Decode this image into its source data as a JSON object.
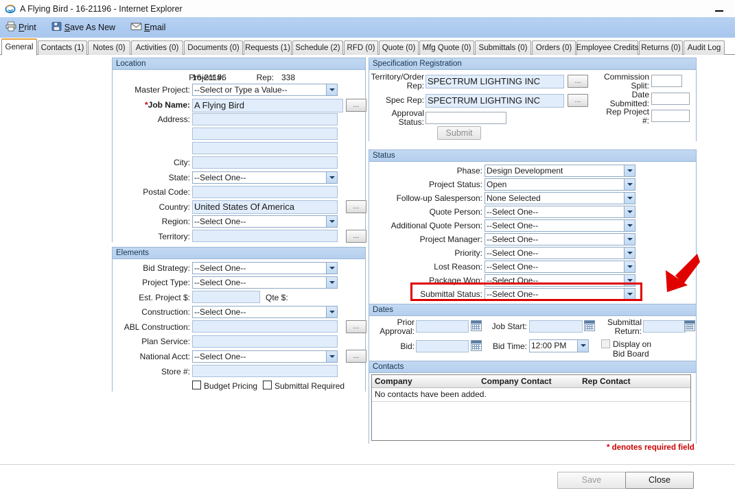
{
  "window": {
    "title": "A Flying Bird - 16-21196 - Internet Explorer",
    "app_icon": "internet-explorer-icon",
    "minimize_label": "—"
  },
  "toolbar": {
    "items": [
      {
        "label": "Print",
        "accel": "P",
        "icon": "printer-icon"
      },
      {
        "label": "Save As New",
        "accel": "S",
        "icon": "save-disk-icon"
      },
      {
        "label": "Email",
        "accel": "E",
        "icon": "envelope-icon"
      }
    ]
  },
  "tabs": [
    {
      "label": "General",
      "active": true
    },
    {
      "label": "Contacts (1)",
      "active": false
    },
    {
      "label": "Notes (0)",
      "active": false
    },
    {
      "label": "Activities (0)",
      "active": false
    },
    {
      "label": "Documents (0)",
      "active": false
    },
    {
      "label": "Requests (1)",
      "active": false
    },
    {
      "label": "Schedule (2)",
      "active": false
    },
    {
      "label": "RFD (0)",
      "active": false
    },
    {
      "label": "Quote (0)",
      "active": false
    },
    {
      "label": "Mfg Quote (0)",
      "active": false
    },
    {
      "label": "Submittals (0)",
      "active": false
    },
    {
      "label": "Orders (0)",
      "active": false
    },
    {
      "label": "Employee Credits",
      "active": false
    },
    {
      "label": "Returns (0)",
      "active": false
    },
    {
      "label": "Audit Log",
      "active": false
    }
  ],
  "location": {
    "title": "Location",
    "project_number_label": "Project #:",
    "project_number_value": "16-21196",
    "rep_label": "Rep:",
    "rep_value": "338",
    "master_project_label": "Master Project:",
    "master_project_value": "--Select or Type a Value--",
    "job_name_label": "Job Name:",
    "job_name_required_mark": "*",
    "job_name_value": "A Flying Bird",
    "address_label": "Address:",
    "address_line1": "",
    "address_line2": "",
    "address_line3": "",
    "city_label": "City:",
    "city_value": "",
    "state_label": "State:",
    "state_value": "--Select One--",
    "postal_label": "Postal Code:",
    "postal_value": "",
    "country_label": "Country:",
    "country_value": "United States Of America",
    "region_label": "Region:",
    "region_value": "--Select One--",
    "territory_label": "Territory:",
    "territory_value": "",
    "ellipsis_label": "..."
  },
  "elements": {
    "title": "Elements",
    "bid_strategy_label": "Bid Strategy:",
    "bid_strategy_value": "--Select One--",
    "project_type_label": "Project Type:",
    "project_type_value": "--Select One--",
    "est_project_label": "Est. Project $:",
    "est_project_value": "",
    "qte_label": "Qte $:",
    "qte_value": "",
    "construction_label": "Construction:",
    "construction_value": "--Select One--",
    "abl_construction_label": "ABL Construction:",
    "abl_construction_value": "",
    "plan_service_label": "Plan Service:",
    "plan_service_value": "",
    "national_acct_label": "National Acct:",
    "national_acct_value": "--Select One--",
    "store_label": "Store #:",
    "store_value": "",
    "budget_pricing_label": "Budget Pricing",
    "budget_pricing_checked": false,
    "submittal_required_label": "Submittal Required",
    "submittal_required_checked": false,
    "ellipsis_label": "..."
  },
  "spec_registration": {
    "title": "Specification Registration",
    "territory_order_rep_label": "Territory/Order Rep:",
    "territory_order_rep_value": "SPECTRUM LIGHTING INC",
    "spec_rep_label": "Spec Rep:",
    "spec_rep_value": "SPECTRUM LIGHTING INC",
    "approval_status_label": "Approval Status:",
    "approval_status_value": "",
    "commission_split_label": "Commission Split:",
    "commission_split_value": "",
    "date_submitted_label": "Date Submitted:",
    "date_submitted_value": "",
    "rep_project_label": "Rep Project #:",
    "rep_project_value": "",
    "submit_label": "Submit",
    "ellipsis_label": "..."
  },
  "status": {
    "title": "Status",
    "rows": [
      {
        "label": "Phase:",
        "value": "Design Development"
      },
      {
        "label": "Project Status:",
        "value": "Open"
      },
      {
        "label": "Follow-up Salesperson:",
        "value": "None Selected"
      },
      {
        "label": "Quote Person:",
        "value": "--Select One--"
      },
      {
        "label": "Additional Quote Person:",
        "value": "--Select One--"
      },
      {
        "label": "Project Manager:",
        "value": "--Select One--"
      },
      {
        "label": "Priority:",
        "value": "--Select One--"
      },
      {
        "label": "Lost Reason:",
        "value": "--Select One--"
      },
      {
        "label": "Package Won:",
        "value": "--Select One--"
      },
      {
        "label": "Submittal Status:",
        "value": "--Select One--"
      }
    ],
    "highlight_color": "#e00000",
    "highlighted_row": "Submittal Status:"
  },
  "dates": {
    "title": "Dates",
    "prior_approval_label": "Prior Approval:",
    "prior_approval_value": "",
    "job_start_label": "Job Start:",
    "job_start_value": "",
    "submittal_return_label": "Submittal Return:",
    "submittal_return_value": "",
    "bid_label": "Bid:",
    "bid_value": "",
    "bid_time_label": "Bid Time:",
    "bid_time_value": "12:00 PM",
    "display_bid_board_label": "Display on Bid Board",
    "display_bid_board_checked": false,
    "calendar_icon": "calendar-icon"
  },
  "contacts": {
    "title": "Contacts",
    "columns": [
      "Company",
      "Company Contact",
      "Rep Contact"
    ],
    "empty_message": "No contacts have been added.",
    "rows": []
  },
  "footer": {
    "required_note": "* denotes required field",
    "save_label": "Save",
    "save_disabled": true,
    "close_label": "Close"
  },
  "annotation": {
    "arrow_color": "#e00000",
    "arrow_name": "red-pointer-arrow",
    "points_to": "Submittal Status:"
  }
}
